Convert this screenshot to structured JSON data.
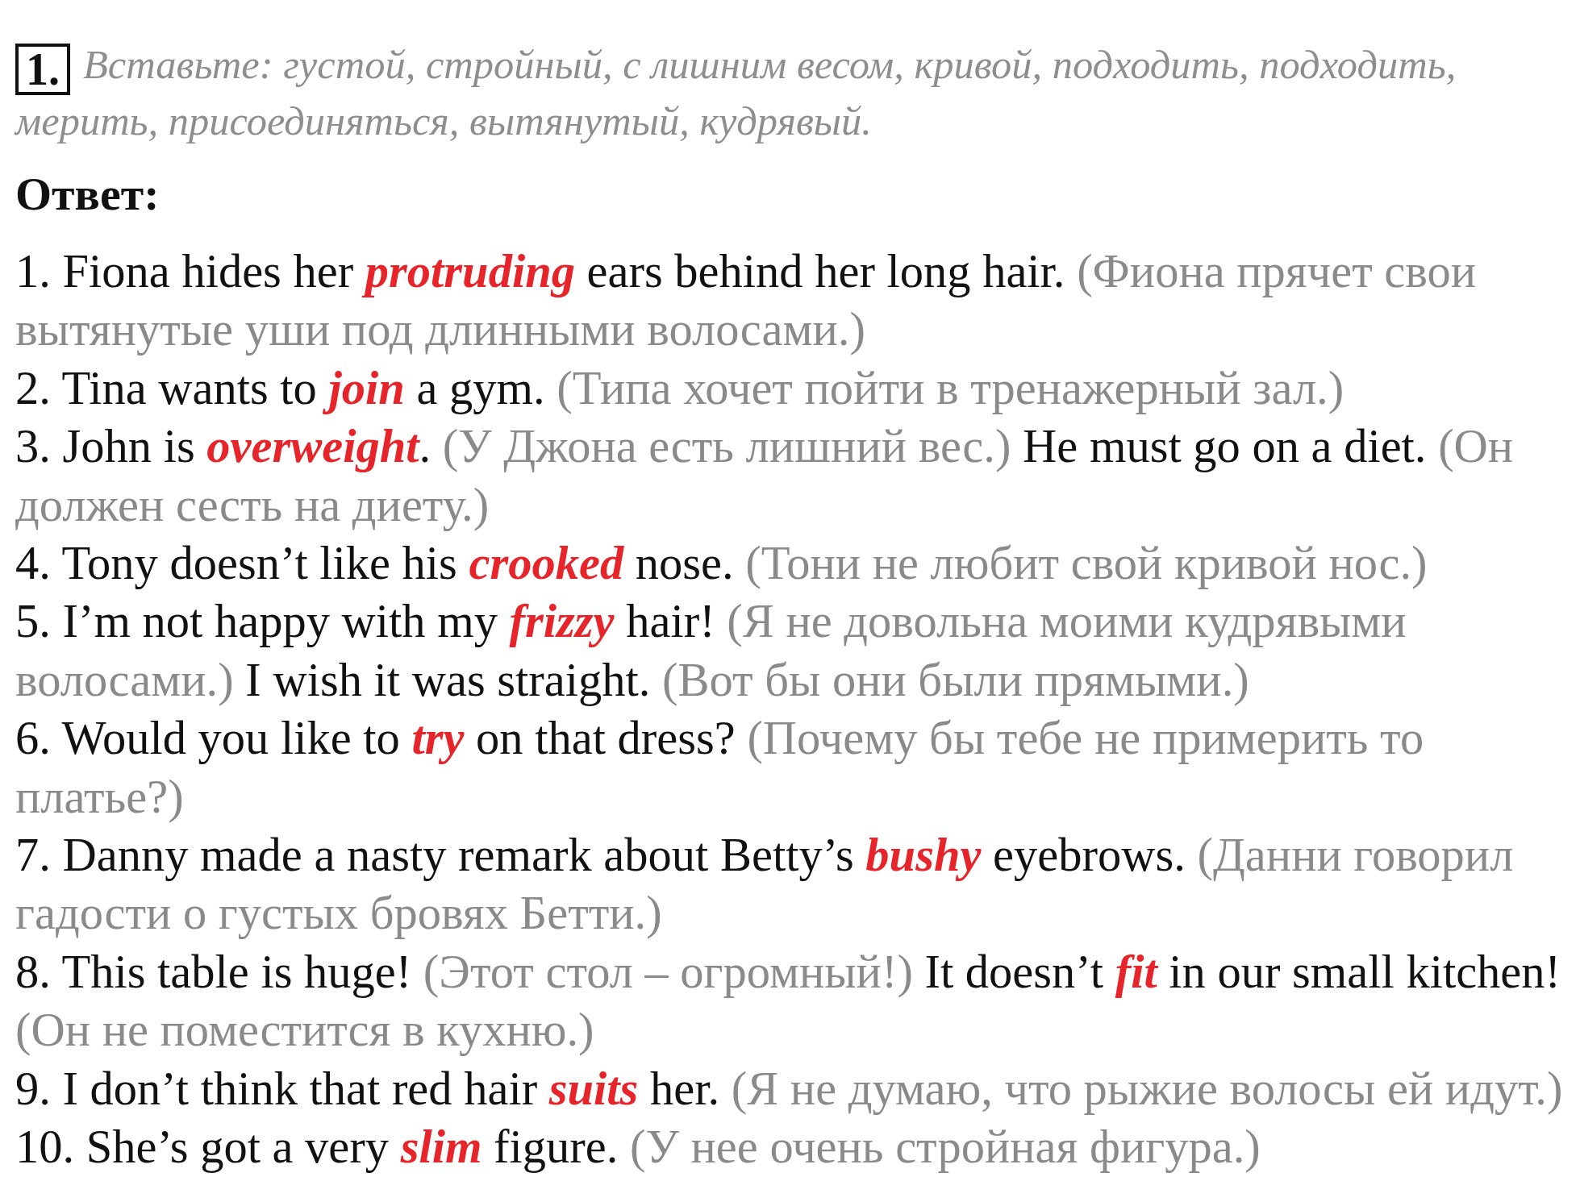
{
  "task": {
    "number": "1.",
    "text": "Вставьте: густой, стройный, с лишним весом, кривой, подходить, подходить, мерить, присоединяться, вытянутый, кудрявый."
  },
  "answer_heading": "Ответ:",
  "items": [
    {
      "number": "1.",
      "segments": [
        {
          "kind": "text",
          "text": "Fiona hides her "
        },
        {
          "kind": "answer",
          "text": "protruding"
        },
        {
          "kind": "text",
          "text": " ears behind her long hair. "
        },
        {
          "kind": "translation",
          "text": "(Фиона прячет свои вытянутые уши под длинными волосами.)"
        }
      ]
    },
    {
      "number": "2.",
      "segments": [
        {
          "kind": "text",
          "text": "Tina wants to "
        },
        {
          "kind": "answer",
          "text": "join"
        },
        {
          "kind": "text",
          "text": " a gym. "
        },
        {
          "kind": "translation",
          "text": "(Типа хочет пойти в тренажерный зал.)"
        }
      ]
    },
    {
      "number": "3.",
      "segments": [
        {
          "kind": "text",
          "text": "John is "
        },
        {
          "kind": "answer",
          "text": "overweight"
        },
        {
          "kind": "text",
          "text": ". "
        },
        {
          "kind": "translation",
          "text": "(У Джона есть лишний вес.)"
        },
        {
          "kind": "text",
          "text": " He must go on a diet. "
        },
        {
          "kind": "translation",
          "text": "(Он должен сесть на диету.)"
        }
      ]
    },
    {
      "number": "4.",
      "segments": [
        {
          "kind": "text",
          "text": "Tony doesn’t like his "
        },
        {
          "kind": "answer",
          "text": "crooked"
        },
        {
          "kind": "text",
          "text": " nose. "
        },
        {
          "kind": "translation",
          "text": "(Тони не любит свой кривой нос.)"
        }
      ]
    },
    {
      "number": "5.",
      "segments": [
        {
          "kind": "text",
          "text": "I’m not happy with my "
        },
        {
          "kind": "answer",
          "text": "frizzy"
        },
        {
          "kind": "text",
          "text": " hair! "
        },
        {
          "kind": "translation",
          "text": "(Я не довольна моими кудрявыми волосами.)"
        },
        {
          "kind": "text",
          "text": " I wish it was straight. "
        },
        {
          "kind": "translation",
          "text": "(Вот бы они были прямыми.)"
        }
      ]
    },
    {
      "number": "6.",
      "segments": [
        {
          "kind": "text",
          "text": "Would you like to "
        },
        {
          "kind": "answer",
          "text": "try"
        },
        {
          "kind": "text",
          "text": " on that dress? "
        },
        {
          "kind": "translation",
          "text": "(Почему бы тебе не примерить то платье?)"
        }
      ]
    },
    {
      "number": "7.",
      "segments": [
        {
          "kind": "text",
          "text": "Danny made a nasty remark about Betty’s "
        },
        {
          "kind": "answer",
          "text": "bushy"
        },
        {
          "kind": "text",
          "text": " eyebrows. "
        },
        {
          "kind": "translation",
          "text": "(Данни говорил гадости о густых бровях Бетти.)"
        }
      ]
    },
    {
      "number": "8.",
      "segments": [
        {
          "kind": "text",
          "text": "This table is huge! "
        },
        {
          "kind": "translation",
          "text": "(Этот стол – огромный!)"
        },
        {
          "kind": "text",
          "text": " It doesn’t "
        },
        {
          "kind": "answer",
          "text": "fit"
        },
        {
          "kind": "text",
          "text": " in our small kitchen! "
        },
        {
          "kind": "translation",
          "text": "(Он не поместится в кухню.)"
        }
      ]
    },
    {
      "number": "9.",
      "segments": [
        {
          "kind": "text",
          "text": "I don’t think that red hair "
        },
        {
          "kind": "answer",
          "text": "suits"
        },
        {
          "kind": "text",
          "text": " her. "
        },
        {
          "kind": "translation",
          "text": "(Я не думаю, что рыжие волосы ей идут.)"
        }
      ]
    },
    {
      "number": "10.",
      "segments": [
        {
          "kind": "text",
          "text": "She’s got a very "
        },
        {
          "kind": "answer",
          "text": "slim"
        },
        {
          "kind": "text",
          "text": " figure. "
        },
        {
          "kind": "translation",
          "text": "(У нее очень стройная фигура.)"
        }
      ]
    }
  ]
}
